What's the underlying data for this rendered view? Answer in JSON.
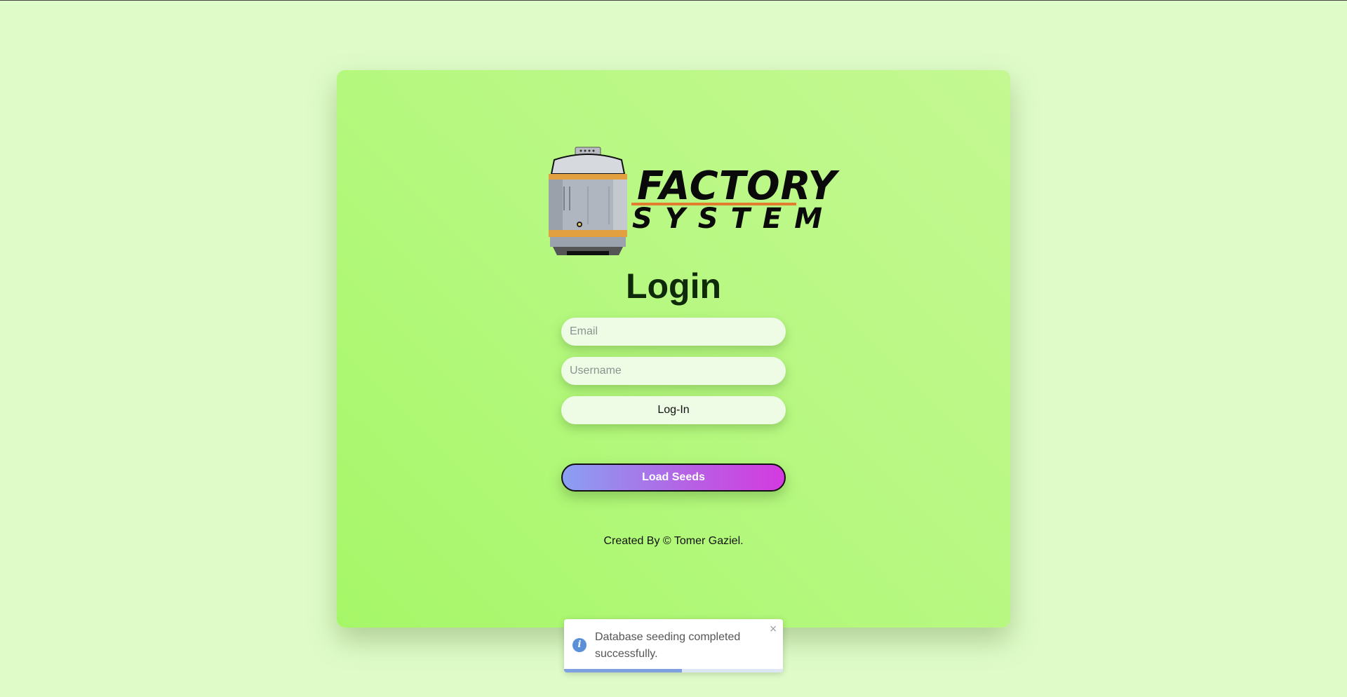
{
  "logo": {
    "line1": "FACTORY",
    "line2": "SYSTEM",
    "icon": "cooling-tower-tank"
  },
  "login": {
    "title": "Login",
    "email_placeholder": "Email",
    "username_placeholder": "Username",
    "login_label": "Log-In",
    "load_seeds_label": "Load Seeds"
  },
  "footer": {
    "credit": "Created By © Tomer Gaziel."
  },
  "toast": {
    "type": "info",
    "message": "Database seeding completed successfully.",
    "close_glyph": "×",
    "progress": 0.54
  },
  "colors": {
    "page_bg": "#dffcc8",
    "card_bg": "#b6f880",
    "accent_gradient_start": "#8aa0f2",
    "accent_gradient_end": "#d43ae0",
    "logo_underline": "#e27d2d",
    "info_blue": "#5b8fd8"
  }
}
